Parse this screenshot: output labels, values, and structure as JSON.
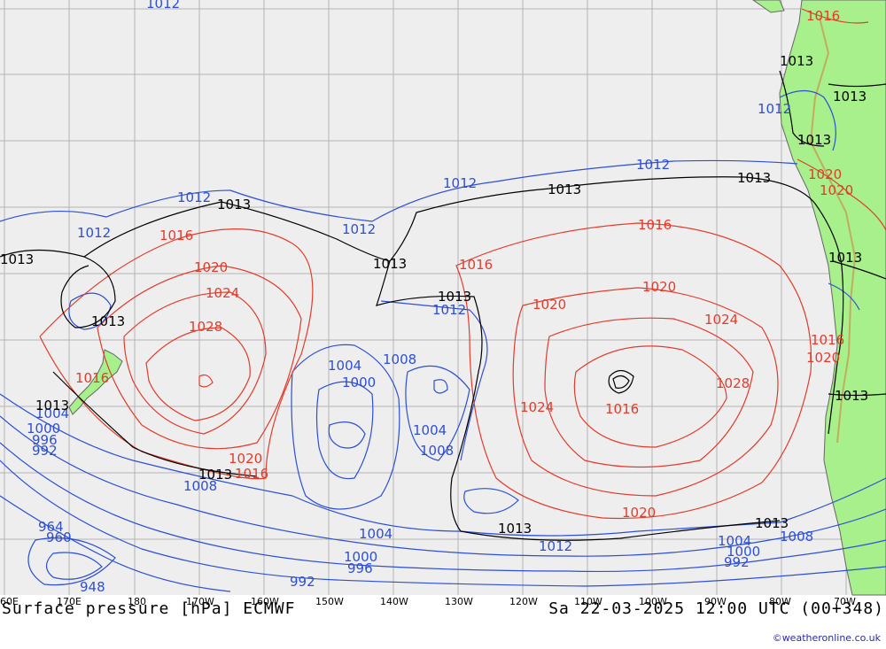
{
  "title": "Surface pressure [hPa] ECMWF",
  "datetime": "Sa 22-03-2025 12:00 UTC (00+348)",
  "credit": "©weatheronline.co.uk",
  "colors": {
    "ocean": "#eeeeee",
    "land": "#a8f08c",
    "grid": "#b4b4b4",
    "isobar_low": "#2d4fd6",
    "isobar_high": "#e33b2b",
    "isobar_1013": "#000000"
  },
  "lon_ticks": [
    "60E",
    "170E",
    "180",
    "170W",
    "160W",
    "150W",
    "140W",
    "130W",
    "120W",
    "110W",
    "100W",
    "90W",
    "80W",
    "70W"
  ],
  "isobar_labels": {
    "blue": [
      "1012",
      "1012",
      "1012",
      "1012",
      "1012",
      "1012",
      "1012",
      "1012",
      "1008",
      "1004",
      "1000",
      "1004",
      "1008",
      "1008",
      "1004",
      "1000",
      "996",
      "992",
      "964",
      "960",
      "948",
      "1000",
      "996",
      "992",
      "1004",
      "1000",
      "992",
      "1008",
      "1012",
      "1004"
    ],
    "red": [
      "1016",
      "1020",
      "1024",
      "1028",
      "1016",
      "1020",
      "1016",
      "1016",
      "1020",
      "1020",
      "1024",
      "1028",
      "1024",
      "1016",
      "1020",
      "1016",
      "1020",
      "1016",
      "1020",
      "1020",
      "1016"
    ],
    "black": [
      "1013",
      "1013",
      "1013",
      "1013",
      "1013",
      "1013",
      "1013",
      "1013",
      "1013",
      "1013",
      "1013",
      "1013",
      "1013",
      "1013",
      "1013",
      "1013"
    ]
  }
}
